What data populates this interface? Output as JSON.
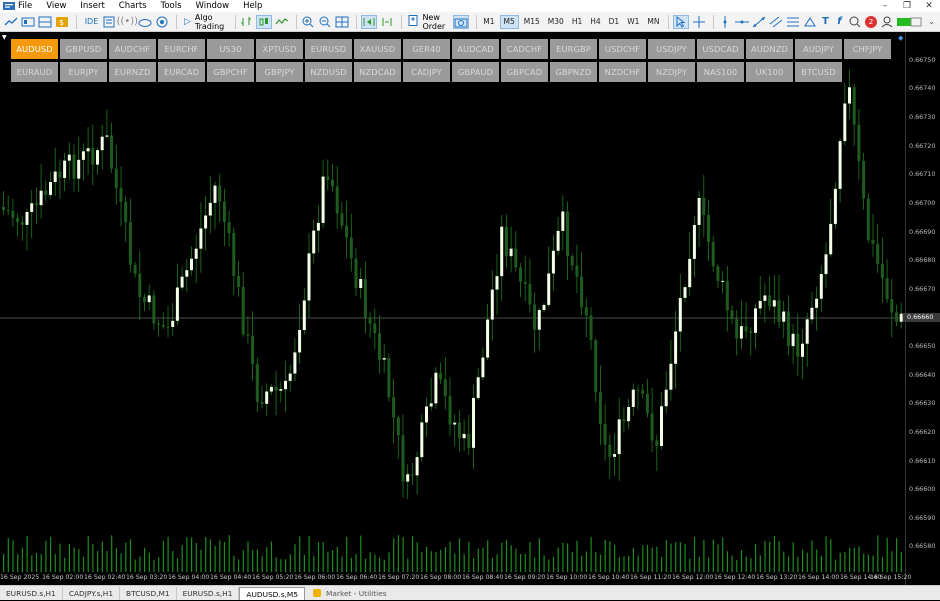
{
  "menu": [
    "File",
    "View",
    "Insert",
    "Charts",
    "Tools",
    "Window",
    "Help"
  ],
  "toolbar": {
    "ide_label": "IDE",
    "algo_trading_label": "Algo Trading",
    "new_order_label": "New Order",
    "timeframes": [
      "M1",
      "M5",
      "M15",
      "M30",
      "H1",
      "H4",
      "D1",
      "W1",
      "MN"
    ],
    "active_timeframe": "M5",
    "notification_count": "2"
  },
  "symbols": {
    "row1": [
      "AUDUSD",
      "GBPUSD",
      "AUDCHF",
      "EURCHF",
      "US30",
      "XPTUSD",
      "EURUSD",
      "XAUUSD",
      "GER40",
      "AUDCAD",
      "CADCHF",
      "EURGBP",
      "USDCHF",
      "USDJPY",
      "USDCAD",
      "AUDNZD",
      "AUDJPY",
      "CHFJPY"
    ],
    "row2": [
      "EURAUD",
      "EURJPY",
      "EURNZD",
      "EURCAD",
      "GBPCHF",
      "GBPJPY",
      "NZDUSD",
      "NZDCAD",
      "CADJPY",
      "GBPAUD",
      "GBPCAD",
      "GBPNZD",
      "NZDCHF",
      "NZDJPY",
      "NAS100",
      "UK100",
      "BTCUSD"
    ],
    "active": "AUDUSD"
  },
  "price_axis": [
    "0.66750",
    "0.66740",
    "0.66730",
    "0.66720",
    "0.66710",
    "0.66700",
    "0.66690",
    "0.66680",
    "0.66670",
    "0.66650",
    "0.66640",
    "0.66630",
    "0.66620",
    "0.66610",
    "0.66600",
    "0.66590",
    "0.66580"
  ],
  "current_price": "0.66660",
  "time_axis": [
    "16 Sep 2025",
    "16 Sep 02:00",
    "16 Sep 02:40",
    "16 Sep 03:20",
    "16 Sep 04:00",
    "16 Sep 04:40",
    "16 Sep 05:20",
    "16 Sep 06:00",
    "16 Sep 06:40",
    "16 Sep 07:20",
    "16 Sep 08:00",
    "16 Sep 08:40",
    "16 Sep 09:20",
    "16 Sep 10:00",
    "16 Sep 10:40",
    "16 Sep 11:20",
    "16 Sep 12:00",
    "16 Sep 12:40",
    "16 Sep 13:20",
    "16 Sep 14:00",
    "16 Sep 14:40",
    "16 Sep 15:20"
  ],
  "tabs": [
    "EURUSD.s,H1",
    "CADJPY.s,H1",
    "BTCUSD,M1",
    "EURUSD.s,H1",
    "AUDUSD.s,M5"
  ],
  "active_tab": "AUDUSD.s,M5",
  "market_tab": "Market - Utilities",
  "colors": {
    "bull": "#f3ffe6",
    "bear": "#1d5c1d",
    "wick": "#1f7a1f",
    "active_symbol": "#f59a0c",
    "symbol_bg": "#9a9a9a"
  },
  "chart_data": {
    "type": "candlestick",
    "symbol": "AUDUSD",
    "timeframe": "M5",
    "ylim": [
      0.66575,
      0.66755
    ],
    "last_price": 0.6666
  }
}
